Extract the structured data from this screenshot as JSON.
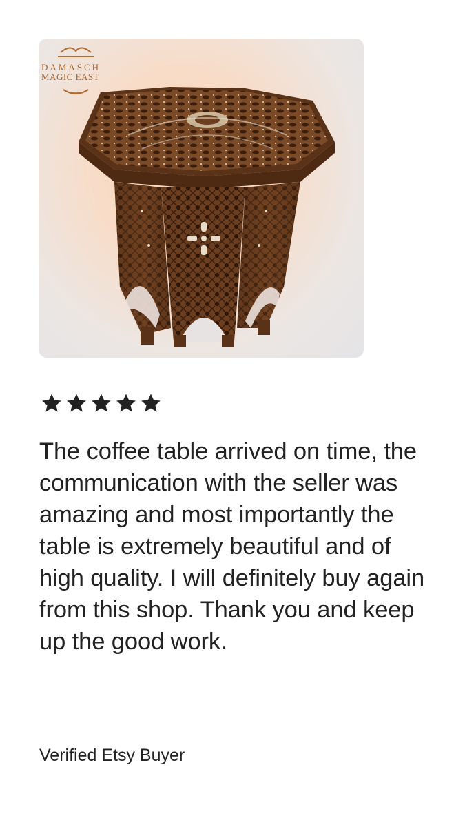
{
  "listing_image": {
    "alt": "Octagonal carved wooden side table with mother-of-pearl inlay",
    "shop_logo": {
      "line1": "DAMASCH",
      "line2": "MAGIC EAST"
    }
  },
  "review": {
    "rating": 5,
    "rating_max": 5,
    "text": "The coffee table arrived on time, the communication with the seller was amazing and most importantly the table is extremely beautiful and of high quality. I will definitely buy again from this shop. Thank you and keep up the good work.",
    "reviewer_label": "Verified Etsy Buyer"
  },
  "colors": {
    "star": "#222222",
    "text": "#222222",
    "logo": "#a8652e",
    "wood_dark": "#5a3218",
    "wood_mid": "#7b4a26"
  }
}
